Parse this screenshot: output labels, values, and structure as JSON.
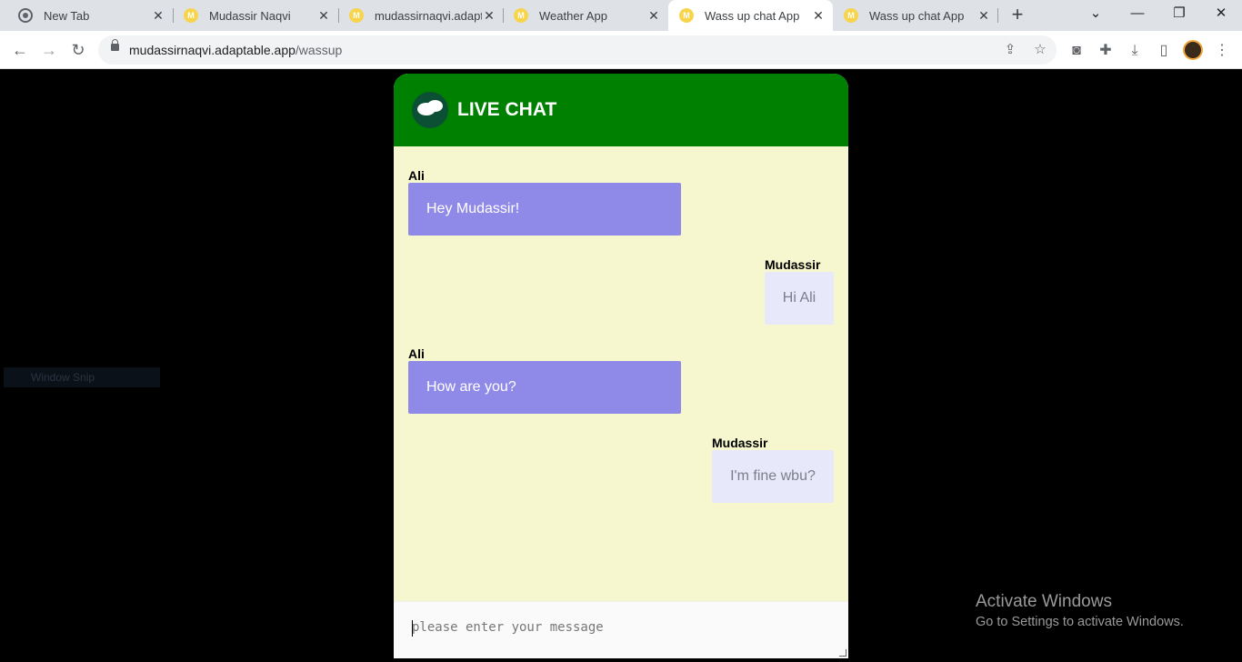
{
  "browser": {
    "tabs": [
      {
        "title": "New Tab",
        "icon": "chrome-icon"
      },
      {
        "title": "Mudassir Naqvi",
        "icon": "m-favicon"
      },
      {
        "title": "mudassirnaqvi.adaptable",
        "icon": "m-favicon"
      },
      {
        "title": "Weather App",
        "icon": "m-favicon"
      },
      {
        "title": "Wass up chat App",
        "icon": "m-favicon",
        "active": true
      },
      {
        "title": "Wass up chat App",
        "icon": "m-favicon"
      }
    ],
    "favicon_letter": "M",
    "url_host": "mudassirnaqvi.adaptable.app",
    "url_path": "/wassup"
  },
  "chat": {
    "title": "LIVE CHAT",
    "header_color": "#008000",
    "background_color": "#f6f7cf",
    "incoming_bubble_color": "#8f8ae8",
    "outgoing_bubble_color": "#e8e8fb",
    "messages": [
      {
        "sender": "Ali",
        "text": "Hey Mudassir!",
        "direction": "incoming"
      },
      {
        "sender": "Mudassir",
        "text": "Hi Ali",
        "direction": "outgoing"
      },
      {
        "sender": "Ali",
        "text": "How are you?",
        "direction": "incoming"
      },
      {
        "sender": "Mudassir",
        "text": "I'm fine wbu?",
        "direction": "outgoing"
      }
    ],
    "input_placeholder": "please enter your message"
  },
  "overlay": {
    "window_snip": "Window Snip",
    "activate_title": "Activate Windows",
    "activate_sub": "Go to Settings to activate Windows."
  }
}
